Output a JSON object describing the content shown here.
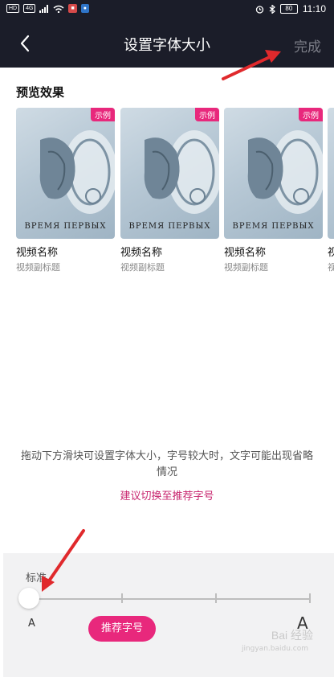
{
  "status_bar": {
    "left_chips": [
      "HD",
      "4G"
    ],
    "time": "11:10",
    "battery": "80"
  },
  "nav": {
    "title": "设置字体大小",
    "done_label": "完成"
  },
  "preview": {
    "section_title": "预览效果",
    "cards": [
      {
        "badge": "示例",
        "poster_text": "BPEMЯ ПEPBЫX",
        "title": "视频名称",
        "subtitle": "视频副标题"
      },
      {
        "badge": "示例",
        "poster_text": "BPEMЯ ПEPBЫX",
        "title": "视频名称",
        "subtitle": "视频副标题"
      },
      {
        "badge": "示例",
        "poster_text": "BPEMЯ ПEPBЫX",
        "title": "视频名称",
        "subtitle": "视频副标题"
      },
      {
        "badge": "",
        "poster_text": "",
        "title": "视",
        "subtitle": "视"
      }
    ]
  },
  "hint_text": "拖动下方滑块可设置字体大小，字号较大时，文字可能出现省略情况",
  "switch_link": "建议切换至推荐字号",
  "slider": {
    "current_label": "标准",
    "small_label": "A",
    "large_label": "A",
    "recommend_label": "推荐字号",
    "value_index": 0,
    "step_count": 4
  },
  "watermark": {
    "main": "Bai 经验",
    "sub": "jingyan.baidu.com"
  },
  "colors": {
    "header_bg": "#1b1d29",
    "accent_pink": "#e8287c",
    "link_color": "#c8266f",
    "annotation_red": "#e0292c"
  }
}
